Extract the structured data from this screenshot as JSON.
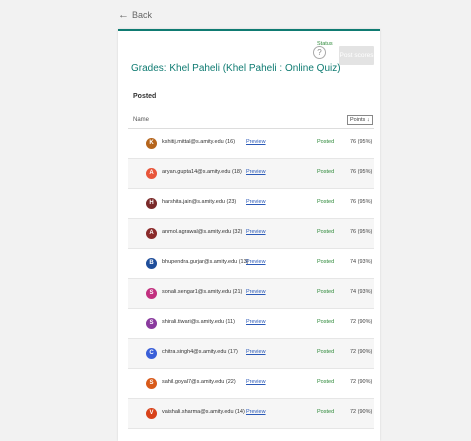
{
  "nav": {
    "back_label": "Back"
  },
  "header": {
    "help_label": "?",
    "post_button_label": "Post scores",
    "title": "Grades: Khel Paheli (Khel Paheli : Online Quiz)",
    "section": "Posted"
  },
  "columns": {
    "name": "Name",
    "status": "Status",
    "points": "Points ↓"
  },
  "rows": [
    {
      "initial": "K",
      "color": "#b5651d",
      "email": "kshitij.mittal@s.amity.edu (16)",
      "preview": "Preview",
      "status": "Posted",
      "points": "76 (95%)"
    },
    {
      "initial": "A",
      "color": "#e8553a",
      "email": "aryan.gupta14@s.amity.edu (18)",
      "preview": "Preview",
      "status": "Posted",
      "points": "76 (95%)"
    },
    {
      "initial": "H",
      "color": "#7a2a2a",
      "email": "harshita.jain@s.amity.edu (23)",
      "preview": "Preview",
      "status": "Posted",
      "points": "76 (95%)"
    },
    {
      "initial": "A",
      "color": "#8a2a2a",
      "email": "anmol.agrawal@s.amity.edu (32)",
      "preview": "Preview",
      "status": "Posted",
      "points": "76 (95%)"
    },
    {
      "initial": "B",
      "color": "#1f4e9a",
      "email": "bhupendra.gurjar@s.amity.edu (13)",
      "preview": "Preview",
      "status": "Posted",
      "points": "74 (93%)"
    },
    {
      "initial": "S",
      "color": "#c2307f",
      "email": "sonali.sengar1@s.amity.edu (21)",
      "preview": "Preview",
      "status": "Posted",
      "points": "74 (93%)"
    },
    {
      "initial": "S",
      "color": "#8a3a9e",
      "email": "shirali.tiwari@s.amity.edu (11)",
      "preview": "Preview",
      "status": "Posted",
      "points": "72 (90%)"
    },
    {
      "initial": "C",
      "color": "#3a5fd8",
      "email": "chitra.singh4@s.amity.edu (17)",
      "preview": "Preview",
      "status": "Posted",
      "points": "72 (90%)"
    },
    {
      "initial": "S",
      "color": "#d85a1a",
      "email": "sahil.goyal7@s.amity.edu (22)",
      "preview": "Preview",
      "status": "Posted",
      "points": "72 (90%)"
    },
    {
      "initial": "V",
      "color": "#d8421a",
      "email": "vaishali.sharma@s.amity.edu (14)",
      "preview": "Preview",
      "status": "Posted",
      "points": "72 (90%)"
    }
  ]
}
